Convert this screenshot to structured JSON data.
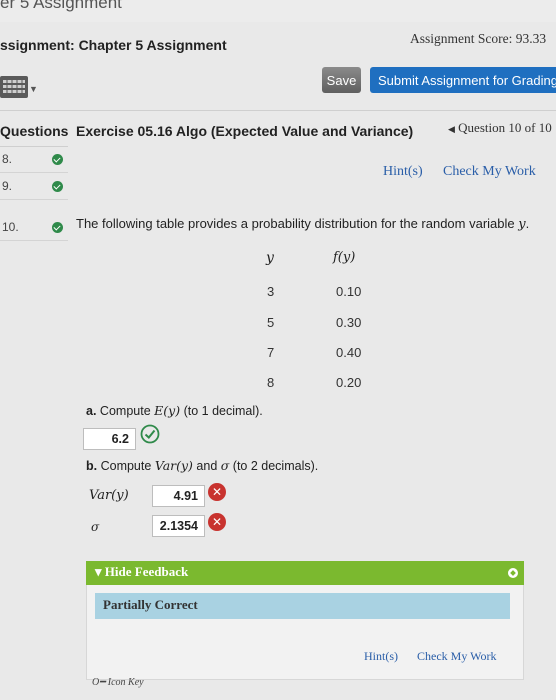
{
  "page_title_fragment": "er 5 Assignment",
  "header": {
    "assignment_title": "ssignment: Chapter 5 Assignment",
    "score_label": "Assignment Score: 93.33"
  },
  "toolbar": {
    "save_label": "Save",
    "submit_label": "Submit Assignment for Grading",
    "keyboard_icon": "keyboard-icon"
  },
  "question_bar": {
    "sidebar_label": "Questions",
    "exercise_title": "Exercise 05.16 Algo (Expected Value and Variance)",
    "nav_label": "Question 10 of 10"
  },
  "sidebar": {
    "items": [
      {
        "number": "8.",
        "status": "complete"
      },
      {
        "number": "9.",
        "status": "complete"
      },
      {
        "number": "10.",
        "status": "complete"
      }
    ]
  },
  "links": {
    "hint": "Hint(s)",
    "check_work": "Check My Work"
  },
  "problem": {
    "intro_text": "The following table provides a probability distribution for the random variable",
    "intro_var": "y",
    "intro_end": ".",
    "table": {
      "header_y": "y",
      "header_fy": "f(y)",
      "rows": [
        {
          "y": "3",
          "fy": "0.10"
        },
        {
          "y": "5",
          "fy": "0.30"
        },
        {
          "y": "7",
          "fy": "0.40"
        },
        {
          "y": "8",
          "fy": "0.20"
        }
      ]
    },
    "part_a": {
      "prefix": "a.",
      "text_before": "Compute",
      "expr": "E(y)",
      "text_after": "(to 1 decimal).",
      "answer": "6.2",
      "status": "correct"
    },
    "part_b": {
      "prefix": "b.",
      "text_before": "Compute",
      "expr": "Var(y)",
      "text_mid": "and",
      "sigma": "σ",
      "text_after": "(to 2 decimals).",
      "var_label": "Var(y)",
      "var_answer": "4.91",
      "var_status": "incorrect",
      "sigma_label": "σ",
      "sigma_answer": "2.1354",
      "sigma_status": "incorrect"
    }
  },
  "feedback": {
    "toggle_label": "Hide Feedback",
    "result": "Partially Correct"
  },
  "footer": {
    "icon_key": "Icon Key"
  },
  "colors": {
    "accent_blue": "#1f6fc0",
    "correct_green": "#2f8a4a",
    "incorrect_red": "#c8332f",
    "feedback_green": "#7bb92f",
    "partial_blue": "#a9d2e2"
  }
}
